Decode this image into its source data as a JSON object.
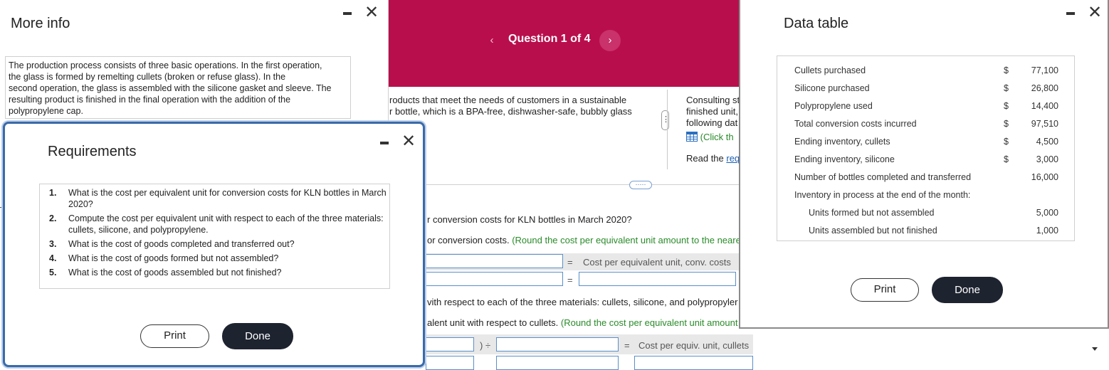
{
  "question": {
    "title": "Question 1 of 4",
    "prev": "‹",
    "next": "›",
    "intro_line1": "roducts that meet the needs of customers in a sustainable",
    "intro_line2": "r bottle, which is a BPA-free, dishwasher-safe, bubbly glass",
    "consult_line1": "Consulting st",
    "consult_line2": "finished unit,",
    "consult_line3": "following dat",
    "click_text": "(Click th",
    "read_prefix": "Read the ",
    "read_link": "req",
    "handle": "·····",
    "part1_question": "r conversion costs for KLN bottles in March 2020?",
    "part1_instr_prefix": "or conversion costs. ",
    "part1_instr_green": "(Round the cost per equivalent unit amount to the neare",
    "eq1": "=",
    "eq1_label": "Cost per equivalent unit, conv. costs",
    "eq2": "=",
    "part2_question": "vith respect to each of the three materials: cullets, silicone, and polypropyler",
    "part2_instr_prefix": "alent unit with respect to cullets. ",
    "part2_instr_green": "(Round the cost per equivalent unit amount",
    "div_sign": ") ÷",
    "eq3": "=",
    "eq3_label": "Cost per equiv. unit, cullets",
    "dots_icon": "⋮"
  },
  "more_info": {
    "title": "More info",
    "lines": [
      "The production process consists of three basic operations. In the first operation,",
      "the glass is formed by remelting cullets (broken or refuse glass). In the",
      "second operation, the glass is assembled with the silicone gasket and sleeve. The",
      "resulting product is finished in the final operation with the addition of the",
      "polypropylene cap."
    ]
  },
  "requirements": {
    "title": "Requirements",
    "items": [
      {
        "num": "1.",
        "text": "What is the cost per equivalent unit for conversion costs for KLN bottles in March 2020?"
      },
      {
        "num": "2.",
        "text": "Compute the cost per equivalent unit with respect to each of the three materials: cullets, silicone, and polypropylene."
      },
      {
        "num": "3.",
        "text": "What is the cost of goods completed and transferred out?"
      },
      {
        "num": "4.",
        "text": "What is the cost of goods formed but not assembled?"
      },
      {
        "num": "5.",
        "text": "What is the cost of goods assembled but not finished?"
      }
    ],
    "print_label": "Print",
    "done_label": "Done"
  },
  "data_table": {
    "title": "Data table",
    "rows": [
      {
        "label": "Cullets purchased",
        "dollar": "$",
        "value": "77,100"
      },
      {
        "label": "Silicone purchased",
        "dollar": "$",
        "value": "26,800"
      },
      {
        "label": "Polypropylene used",
        "dollar": "$",
        "value": "14,400"
      },
      {
        "label": "Total conversion costs incurred",
        "dollar": "$",
        "value": "97,510"
      },
      {
        "label": "Ending inventory, cullets",
        "dollar": "$",
        "value": "4,500"
      },
      {
        "label": "Ending inventory, silicone",
        "dollar": "$",
        "value": "3,000"
      },
      {
        "label": "Number of bottles completed and transferred",
        "dollar": "",
        "value": "16,000"
      },
      {
        "label": "Inventory in process at the end of the month:",
        "dollar": "",
        "value": ""
      },
      {
        "label": "Units formed but not assembled",
        "dollar": "",
        "value": "5,000"
      },
      {
        "label": "Units assembled but not finished",
        "dollar": "",
        "value": "1,000"
      }
    ],
    "print_label": "Print",
    "done_label": "Done"
  }
}
